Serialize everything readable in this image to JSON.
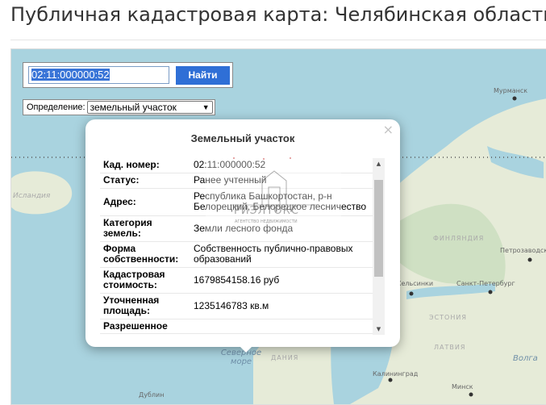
{
  "page": {
    "title": "Публичная кадастровая карта: Челябинская область"
  },
  "search": {
    "value": "02:11:000000:52",
    "button_label": "Найти"
  },
  "definition": {
    "label": "Определение:",
    "selected": "земельный участок"
  },
  "popup": {
    "title": "Земельный участок",
    "close_symbol": "×",
    "rows": [
      {
        "label": "Кад. номер:",
        "value": "02:11:000000:52"
      },
      {
        "label": "Статус:",
        "value": "Ранее учтенный"
      },
      {
        "label": "Адрес:",
        "value": "Республика Башкортостан, р-н Белорецкий, Белорецкое лесничество"
      },
      {
        "label": "Категория земель:",
        "value": "Земли лесного фонда"
      },
      {
        "label": "Форма собственности:",
        "value": "Собственность публично-правовых образований"
      },
      {
        "label": "Кадастровая стоимость:",
        "value": "1679854158.16 руб"
      },
      {
        "label": "Уточненная площадь:",
        "value": "1235146783 кв.м"
      },
      {
        "label": "Разрешенное",
        "value": ""
      }
    ]
  },
  "watermark": {
    "brand": "РИЭЛТОКС",
    "tagline": "АГЕНТСТВО НЕДВИЖИМОСТИ"
  },
  "map": {
    "labels": {
      "murmansk": "Мурманск",
      "iceland": "Исландия",
      "finland": "ФИНЛЯНДИЯ",
      "petrozavodsk": "Петрозаводск",
      "helsinki": "Хельсинки",
      "spb": "Санкт-Петербург",
      "estonia": "ЭСТОНИЯ",
      "latvia": "ЛАТВИЯ",
      "north_sea": "Северное море",
      "denmark": "ДАНИЯ",
      "kaliningrad": "Калининград",
      "minsk": "Минск",
      "dublin": "Дублин",
      "volga": "Волга"
    },
    "colors": {
      "water": "#a9d3df",
      "land": "#e6ebd8",
      "land_forest": "#cfe0c3",
      "button": "#2f6fd6"
    }
  }
}
